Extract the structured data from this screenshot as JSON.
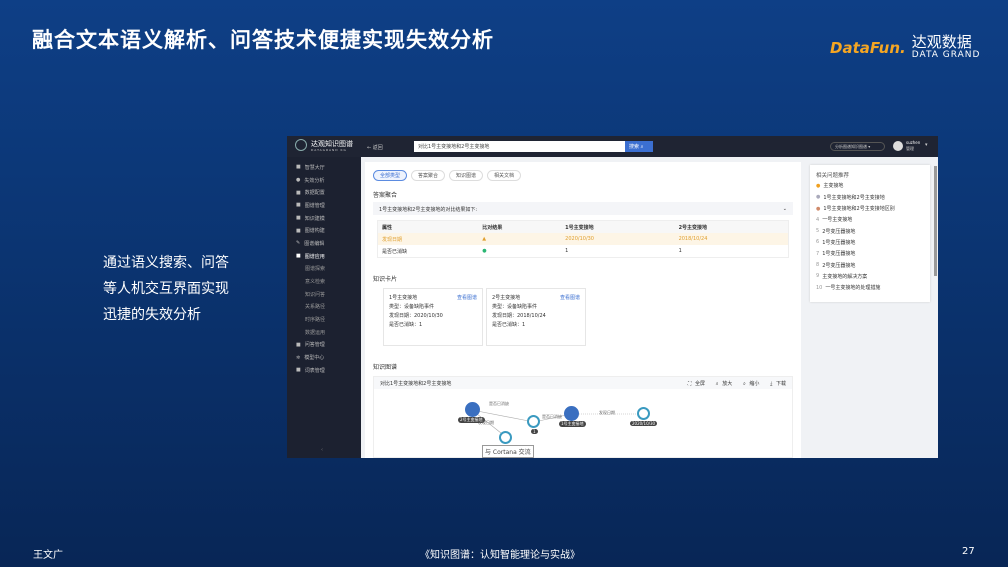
{
  "slide": {
    "title": "融合文本语义解析、问答技术便捷实现失效分析",
    "logo_brand": "DataFun.",
    "logo_cn": "达观数据",
    "logo_en": "DATA GRAND",
    "description": [
      "通过语义搜索、问答",
      "等人机交互界面实现",
      "迅捷的失效分析"
    ],
    "footer_author": "王文广",
    "footer_book": "《知识图谱：认知智能理论与实战》",
    "page_number": "27"
  },
  "app": {
    "brand": "达观知识图谱",
    "brand_sub": "DATAGRAND KG",
    "back": "← 返回",
    "search_value": "对比1号主变接地和2号主变接地",
    "search_button": "搜索",
    "graph_select": "分析图谱知识图谱",
    "user_name": "suzhen",
    "user_role": "管理",
    "sidebar": [
      {
        "label": "智慧大厅"
      },
      {
        "label": "失效分析"
      },
      {
        "label": "数据配置"
      },
      {
        "label": "图谱管理"
      },
      {
        "label": "知识建模"
      },
      {
        "label": "图谱构建"
      },
      {
        "label": "图谱编辑"
      },
      {
        "label": "图谱应用"
      }
    ],
    "sidebar_sub": [
      "图谱探索",
      "意义检索",
      "知识问答",
      "关系路径",
      "时序路径",
      "数据运用"
    ],
    "sidebar_after": [
      {
        "label": "问答管理"
      },
      {
        "label": "模型中心"
      },
      {
        "label": "词表管理"
      }
    ],
    "tabs": [
      "全部类型",
      "答案聚合",
      "知识图谱",
      "相关文档"
    ],
    "answer_title": "答案聚合",
    "answer_summary": "1号主变接地和2号主变接地的对比结果如下:",
    "table": {
      "headers": [
        "属性",
        "比对结果",
        "1号主变接地",
        "2号主变接地"
      ],
      "rows": [
        [
          "发现日期",
          "warning",
          "2020/10/30",
          "2018/10/24"
        ],
        [
          "是否已消缺",
          "ok",
          "1",
          "1"
        ]
      ]
    },
    "cards_title": "知识卡片",
    "cards": [
      {
        "name": "1号主变接地",
        "link": "查看图谱",
        "type": "类型：设备缺陷事件",
        "date": "发现日期：2020/10/30",
        "fixed": "是否已消缺：1"
      },
      {
        "name": "2号主变接地",
        "link": "查看图谱",
        "type": "类型：设备缺陷事件",
        "date": "发现日期：2018/10/24",
        "fixed": "是否已消缺：1"
      }
    ],
    "graph_title": "知识图谱",
    "graph_caption": "对比1号主变接地和2号主变接地",
    "graph_tools": [
      "全屏",
      "放大",
      "缩小",
      "下载"
    ],
    "graph_nodes": [
      "2号主变接地",
      "1",
      "1号主变接地",
      "2020/10/30"
    ],
    "graph_edges": [
      "是否已消缺",
      "发现日期",
      "是否已消缺",
      "发现日期"
    ],
    "tooltip": "与 Cortana 交流",
    "related_title": "相关问题推荐",
    "related": [
      "主变接地",
      "1号主变接地和2号主变接地",
      "1号主变接地和2号主变接地区别",
      "一号主变接地",
      "2号变压器接地",
      "1号变压器接地",
      "1号变压器接地",
      "2号变压器接地",
      "主变接地的解决方案",
      "一号主变接地的处理措施"
    ]
  },
  "colors": {
    "accent": "#3b6fd1",
    "warning": "#f0a020",
    "ok": "#2bb673",
    "node": "#3a6fc0"
  }
}
